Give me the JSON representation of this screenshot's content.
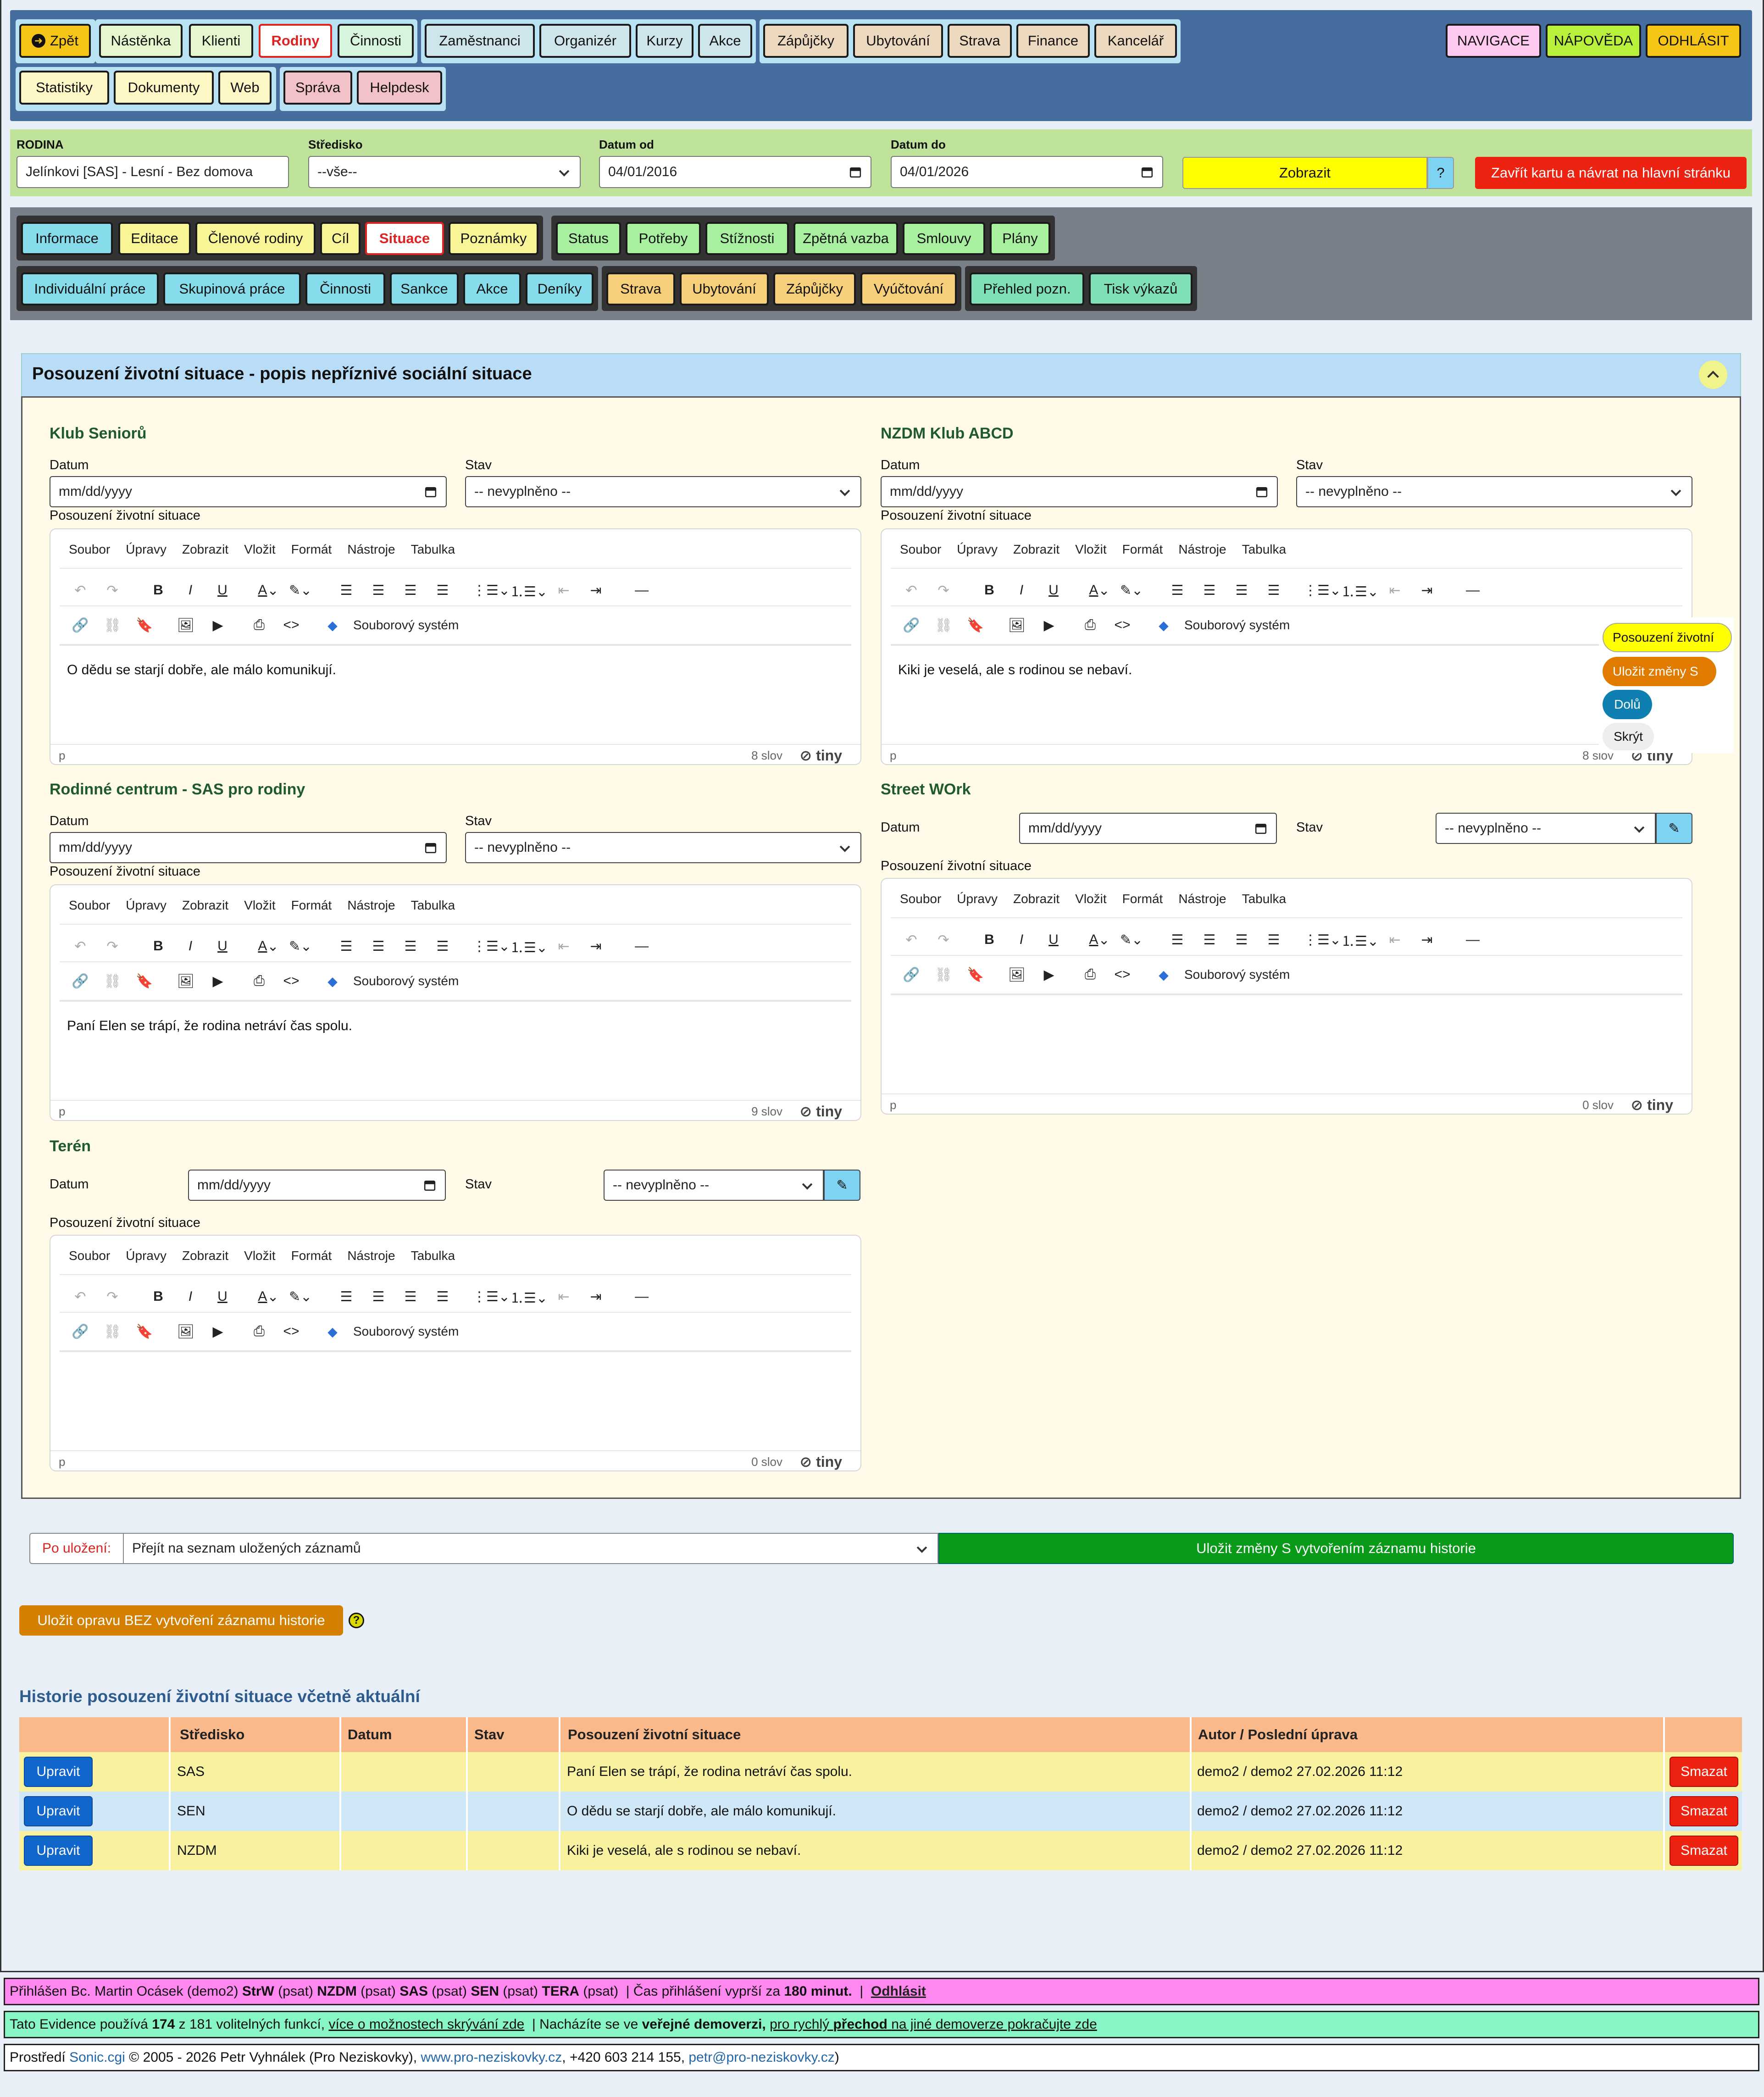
{
  "topnav": {
    "back": "Zpět",
    "g1": [
      "Nástěnka",
      "Klienti",
      "Rodiny",
      "Činnosti"
    ],
    "g2": [
      "Zaměstnanci",
      "Organizér",
      "Kurzy",
      "Akce"
    ],
    "g3": [
      "Zápůjčky",
      "Ubytování",
      "Strava",
      "Finance",
      "Kancelář"
    ],
    "g4": [
      "Statistiky",
      "Dokumenty",
      "Web"
    ],
    "g5": [
      "Správa",
      "Helpdesk"
    ],
    "right": [
      "NAVIGACE",
      "NÁPOVĚDA",
      "ODHLÁSIT"
    ]
  },
  "filter": {
    "rodina_label": "RODINA",
    "rodina_value": "Jelínkovi [SAS] - Lesní - Bez domova",
    "stredisko_label": "Středisko",
    "stredisko_value": "--vše--",
    "datum_od_label": "Datum od",
    "datum_od_value": "04/01/2016",
    "datum_do_label": "Datum do",
    "datum_do_value": "04/01/2026",
    "zobrazit": "Zobrazit",
    "help": "?",
    "zavrit": "Zavřít kartu a návrat na hlavní stránku"
  },
  "subnav": {
    "r1a": [
      "Informace",
      "Editace",
      "Členové rodiny",
      "Cíl",
      "Situace",
      "Poznámky"
    ],
    "r1b": [
      "Status",
      "Potřeby",
      "Stížnosti",
      "Zpětná vazba",
      "Smlouvy",
      "Plány"
    ],
    "r2a": [
      "Individuální práce",
      "Skupinová práce",
      "Činnosti",
      "Sankce",
      "Akce",
      "Deníky"
    ],
    "r2b": [
      "Strava",
      "Ubytování",
      "Zápůjčky",
      "Vyúčtování"
    ],
    "r2c": [
      "Přehled pozn.",
      "Tisk výkazů"
    ]
  },
  "panel": {
    "title": "Posouzení životní situace - popis nepříznivé sociální situace",
    "datum_label": "Datum",
    "stav_label": "Stav",
    "posouzeni_label": "Posouzení životní situace",
    "date_placeholder": "mm/dd/yyyy",
    "stav_value": "-- nevyplněno --",
    "editor_menu": [
      "Soubor",
      "Úpravy",
      "Zobrazit",
      "Vložit",
      "Formát",
      "Nástroje",
      "Tabulka"
    ],
    "file_system": "Souborový systém",
    "p_tag": "p",
    "tiny": "tiny",
    "sections": [
      {
        "name": "Klub Seniorů",
        "text": "O dědu se starjí dobře, ale málo komunikují.",
        "words": "8 slov"
      },
      {
        "name": "NZDM Klub ABCD",
        "text": "Kiki je veselá, ale s rodinou se nebaví.",
        "words": "8 slov"
      },
      {
        "name": "Rodinné centrum - SAS pro rodiny",
        "text": "Paní Elen se trápí, že rodina netráví čas spolu.",
        "words": "9 slov"
      },
      {
        "name": "Street WOrk",
        "text": "",
        "words": "0 slov"
      },
      {
        "name": "Terén",
        "text": "",
        "words": "0 slov"
      }
    ]
  },
  "floating": [
    "Posouzení životní",
    "Uložit změny S",
    "Dolů",
    "Skrýt"
  ],
  "save": {
    "po_ulozeni_label": "Po uložení:",
    "po_ulozeni_value": "Přejít na seznam uložených záznamů",
    "ulozit_s": "Uložit změny S vytvořením záznamu historie",
    "ulozit_bez": "Uložit opravu BEZ vytvoření záznamu historie"
  },
  "history": {
    "title": "Historie posouzení životní situace včetně aktuální",
    "headers": [
      "",
      "Středisko",
      "Datum",
      "Stav",
      "Posouzení životní situace",
      "Autor / Poslední úprava",
      ""
    ],
    "rows": [
      {
        "edit": "Upravit",
        "stredisko": "SAS",
        "datum": "",
        "stav": "",
        "text": "Paní Elen se trápí, že rodina netráví čas spolu.",
        "autor": "demo2 / demo2 27.02.2026 11:12",
        "del": "Smazat"
      },
      {
        "edit": "Upravit",
        "stredisko": "SEN",
        "datum": "",
        "stav": "",
        "text": "O dědu se starjí dobře, ale málo komunikují.",
        "autor": "demo2 / demo2 27.02.2026 11:12",
        "del": "Smazat"
      },
      {
        "edit": "Upravit",
        "stredisko": "NZDM",
        "datum": "",
        "stav": "",
        "text": "Kiki je veselá, ale s rodinou se nebaví.",
        "autor": "demo2 / demo2 27.02.2026 11:12",
        "del": "Smazat"
      }
    ]
  },
  "footer": {
    "l1": {
      "a": "Přihlášen Bc. Martin Ocásek (demo2)",
      "b": "StrW",
      "c": "(psat)",
      "d": "NZDM",
      "e": "(psat)",
      "f": "SAS",
      "g": "(psat)",
      "h": "SEN",
      "i": "(psat)",
      "j": "TERA",
      "k": "(psat)",
      "l": "| Čas přihlášení vyprší za",
      "m": "180 minut.",
      "n": "|",
      "o": "Odhlásit"
    },
    "l2": {
      "a": "Tato Evidence používá",
      "b": "174",
      "c": "z 181 volitelných funkcí,",
      "d": "více o možnostech skrývání zde",
      "e": "| Nacházíte se ve",
      "f": "veřejné demoverzi,",
      "g": "pro rychlý",
      "h": "přechod",
      "i": "na jiné demoverze pokračujte zde"
    },
    "l3": {
      "a": "Prostředí",
      "b": "Sonic.cgi",
      "c": "© 2005 - 2026 Petr Vyhnálek (Pro Neziskovky),",
      "d": "www.pro-neziskovky.cz",
      "e": ", +420 603 214 155,",
      "f": "petr@pro-neziskovky.cz",
      ")": ")"
    }
  },
  "colors": {
    "topbar": "#456d9e",
    "filterbar": "#bfe39a",
    "subnav": "#7a8089",
    "panel": "#fffbe8",
    "green": "#0a9a1a"
  }
}
